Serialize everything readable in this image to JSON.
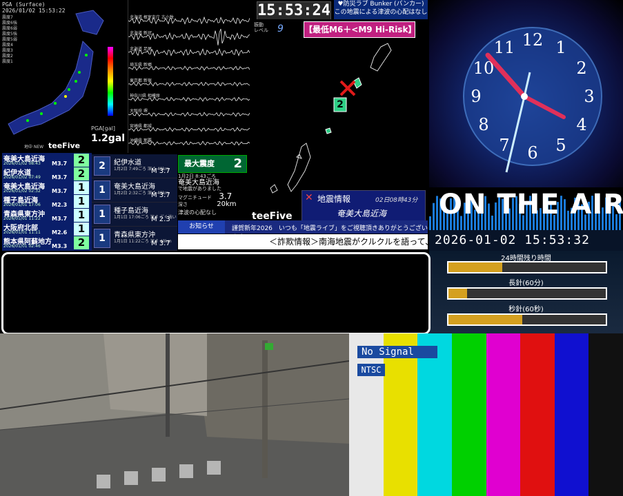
{
  "pga": {
    "title": "PGA (Surface)",
    "datetime": "2026/01/02 15:53:22",
    "legend_lines": [
      "震度7",
      "震度6強",
      "震度6弱",
      "震度5強",
      "震度5弱",
      "震度4",
      "震度3",
      "震度2",
      "震度1"
    ],
    "gal_label": "PGA[gal]",
    "gal_value": "1.2gal",
    "brand": "teeFive",
    "brand_prefix": "地中 NEW"
  },
  "waveforms": {
    "labels": [
      "北海道 根室支庁 古小牧",
      "北海道 新冠",
      "北海道 足尾",
      "埼玉県 新郷",
      "東京都 新宿",
      "神奈川県 相模原",
      "大阪府 堺",
      "宮崎県 都城",
      "沖縄県 那覇"
    ]
  },
  "clock_display": {
    "time": "15:53:24"
  },
  "ews_header": {
    "line1": "♥防災ラブ Bunker (バンカー)",
    "line2": "この地震による津波の心配はなし"
  },
  "seismic_map": {
    "level_label": "振動\nレベル",
    "level_value": "9",
    "risk_label": "【最低M6＋<M9 Hi-Risk】",
    "epicenter_intensity": "2",
    "brand": "teeFive"
  },
  "eq_info": {
    "title": "地震情報",
    "date": "02日08時43分",
    "place": "奄美大島近海"
  },
  "clock": {
    "numbers": [
      "12",
      "1",
      "2",
      "3",
      "4",
      "5",
      "6",
      "7",
      "8",
      "9",
      "10",
      "11"
    ],
    "onair_text": "ON THE AIR",
    "datetime": "2026-01-02 15:53:32",
    "bars": [
      {
        "label": "24時間残り時間",
        "fraction": 0.34
      },
      {
        "label": "長針(60分)",
        "fraction": 0.12
      },
      {
        "label": "秒針(60秒)",
        "fraction": 0.47
      }
    ]
  },
  "quake_list": [
    {
      "place": "奄美大島近海",
      "time": "2026/01/02 08:43",
      "mag": "M3.7",
      "intensity": "2",
      "color": "#7fff9f"
    },
    {
      "place": "紀伊水道",
      "time": "2026/01/02 07:49",
      "mag": "M3.7",
      "intensity": "2",
      "color": "#7fff9f"
    },
    {
      "place": "奄美大島近海",
      "time": "2026/01/02 02:32",
      "mag": "M3.7",
      "intensity": "1",
      "color": "#ccffff"
    },
    {
      "place": "種子島近海",
      "time": "2026/01/01 17:06",
      "mag": "M2.3",
      "intensity": "1",
      "color": "#ccffff"
    },
    {
      "place": "青森県東方沖",
      "time": "2026/01/01 11:22",
      "mag": "M3.7",
      "intensity": "1",
      "color": "#ccffff"
    },
    {
      "place": "大阪府北部",
      "time": "2026/01/01 11:11",
      "mag": "M2.6",
      "intensity": "1",
      "color": "#ccffff"
    },
    {
      "place": "熊本県阿蘇地方",
      "time": "2026/01/01 02:46",
      "mag": "M3.3",
      "intensity": "2",
      "color": "#7fff9f"
    }
  ],
  "detail_cards": [
    {
      "place": "紀伊水道",
      "sub": "1月2日 7:49ごろ 深さ 40km",
      "mag": "M 3.7",
      "intensity": "2"
    },
    {
      "place": "奄美大島近海",
      "sub": "1月2日 2:32ごろ 深さ 40km",
      "mag": "M 3.7",
      "intensity": "1"
    },
    {
      "place": "種子島近海",
      "sub": "1月1日 17:06ごろ 深さ ごく浅い",
      "mag": "M 2.3",
      "intensity": "1"
    },
    {
      "place": "青森県東方沖",
      "sub": "1月1日 11:22ごろ 深さ 40km",
      "mag": "M 3.7",
      "intensity": "1"
    }
  ],
  "max_intensity": {
    "label": "最大震度",
    "value": "2"
  },
  "summary": {
    "time": "1月2日 8:43ごろ",
    "place": "奄美大島近海",
    "note": "で地震がありました",
    "mag_label": "マグニチュード",
    "mag_value": "3.7",
    "depth_label": "深さ",
    "depth_value": "20km",
    "tsunami": "津波の心配なし"
  },
  "notice": {
    "label": "お知らせ",
    "message": "謹賀新年2026　いつも「地震ライブ」をご視聴頂きありがとうございます!"
  },
  "ticker": {
    "text": "＜詐欺情報＞南海地震がクルクルを語って、"
  },
  "test_pattern": {
    "no_signal": "No Signal",
    "ntsc": "NTSC",
    "colors": [
      "#e8e8e8",
      "#e8e000",
      "#00d8e0",
      "#00d000",
      "#e000d0",
      "#e01010",
      "#1010d0",
      "#111111"
    ]
  }
}
